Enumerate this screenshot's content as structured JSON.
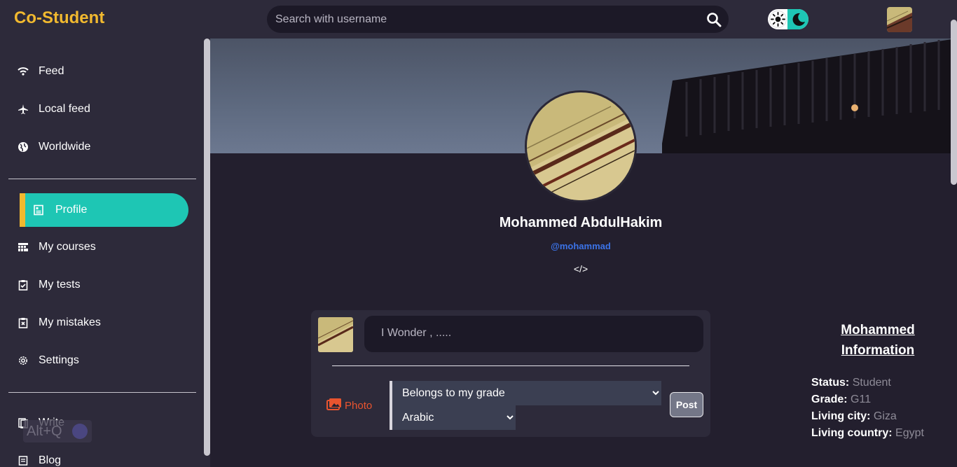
{
  "app": {
    "brand": "Co-Student"
  },
  "search": {
    "placeholder": "Search with username",
    "icon": "search-icon"
  },
  "theme_toggle": {
    "light_icon": "sun-icon",
    "dark_icon": "moon-icon"
  },
  "sidebar": {
    "items": [
      {
        "label": "Feed",
        "icon": "wifi-icon"
      },
      {
        "label": "Local feed",
        "icon": "airplane-icon"
      },
      {
        "label": "Worldwide",
        "icon": "globe-icon"
      },
      {
        "label": "Profile",
        "icon": "profile-card-icon",
        "active": true
      },
      {
        "label": "My courses",
        "icon": "courses-icon"
      },
      {
        "label": "My tests",
        "icon": "clipboard-check-icon"
      },
      {
        "label": "My mistakes",
        "icon": "clipboard-x-icon"
      },
      {
        "label": "Settings",
        "icon": "gear-icon"
      },
      {
        "label": "Write",
        "icon": "write-icon"
      },
      {
        "label": "Blog",
        "icon": "blog-icon"
      }
    ]
  },
  "overlay": {
    "shortcut": "Alt+Q"
  },
  "profile": {
    "name": "Mohammed AbdulHakim",
    "handle": "@mohammad",
    "bio": "</>"
  },
  "composer": {
    "placeholder": "I Wonder , .....",
    "photo_label": "Photo",
    "audience_selected": "Belongs to my grade",
    "language_selected": "Arabic",
    "post_label": "Post"
  },
  "info": {
    "title": "Mohammed Information",
    "rows": [
      {
        "key": "Status:",
        "value": "Student"
      },
      {
        "key": "Grade:",
        "value": "G11"
      },
      {
        "key": "Living city:",
        "value": "Giza"
      },
      {
        "key": "Living country:",
        "value": "Egypt"
      }
    ]
  },
  "colors": {
    "brand": "#f1b92f",
    "accent": "#1ec6b4",
    "background": "#231f2e",
    "panel": "#2d2a3a",
    "handle": "#3b73e8",
    "photo": "#e9542f"
  }
}
